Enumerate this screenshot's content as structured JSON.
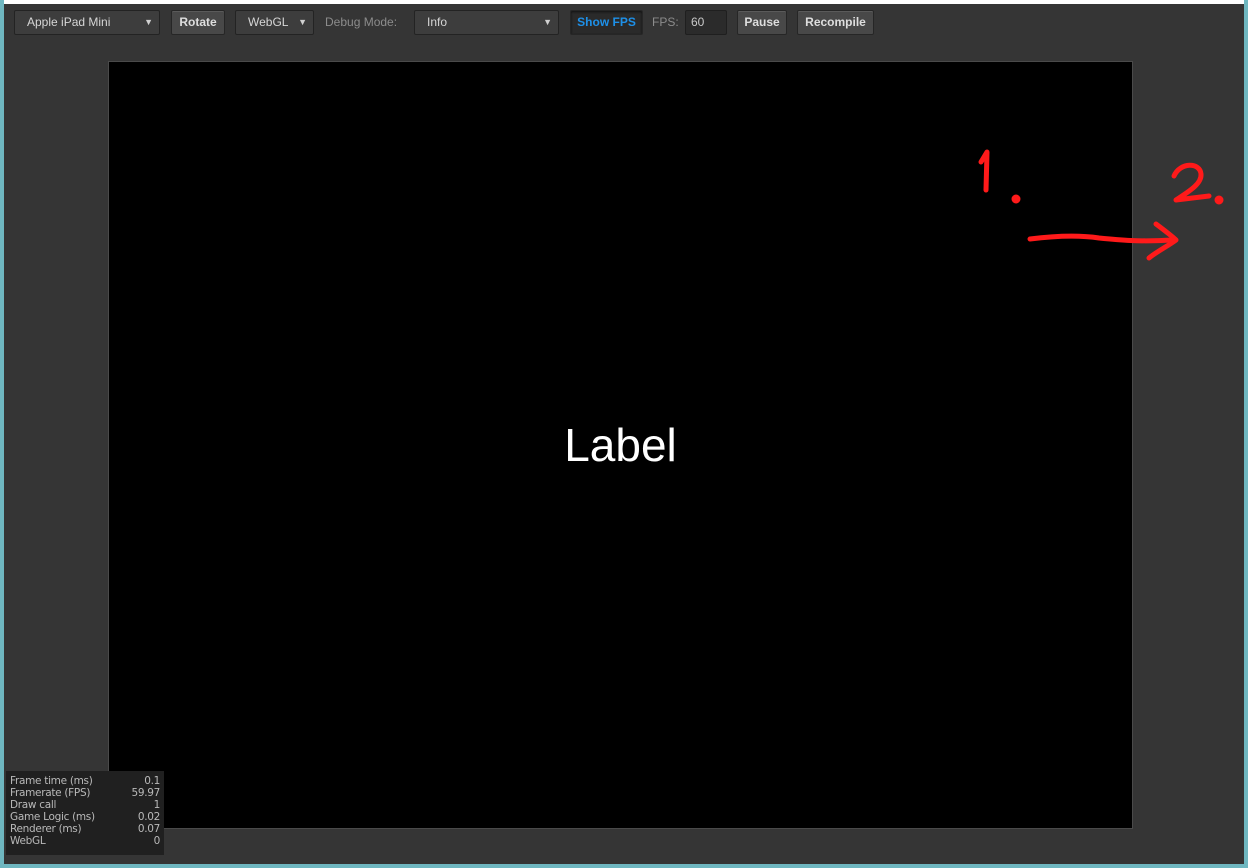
{
  "toolbar": {
    "device": {
      "value": "Apple iPad Mini"
    },
    "rotate_label": "Rotate",
    "renderer": {
      "value": "WebGL"
    },
    "debug_mode_label": "Debug Mode:",
    "debug_mode": {
      "value": "Info"
    },
    "show_fps_label": "Show FPS",
    "fps_label": "FPS:",
    "fps_value": "60",
    "pause_label": "Pause",
    "recompile_label": "Recompile"
  },
  "stage": {
    "label_text": "Label"
  },
  "stats": {
    "rows": [
      {
        "name": "Frame time (ms)",
        "value": "0.1"
      },
      {
        "name": "Framerate (FPS)",
        "value": "59.97"
      },
      {
        "name": "Draw call",
        "value": "1"
      },
      {
        "name": "Game Logic (ms)",
        "value": "0.02"
      },
      {
        "name": "Renderer (ms)",
        "value": "0.07"
      },
      {
        "name": "WebGL",
        "value": "0"
      }
    ]
  },
  "annotations": {
    "marker_1": "1.",
    "marker_2": "2.",
    "color": "#ff1a1a"
  },
  "colors": {
    "background": "#353535",
    "stage": "#000000",
    "accent": "#1e90e8",
    "frame": "#6fb7c0"
  }
}
